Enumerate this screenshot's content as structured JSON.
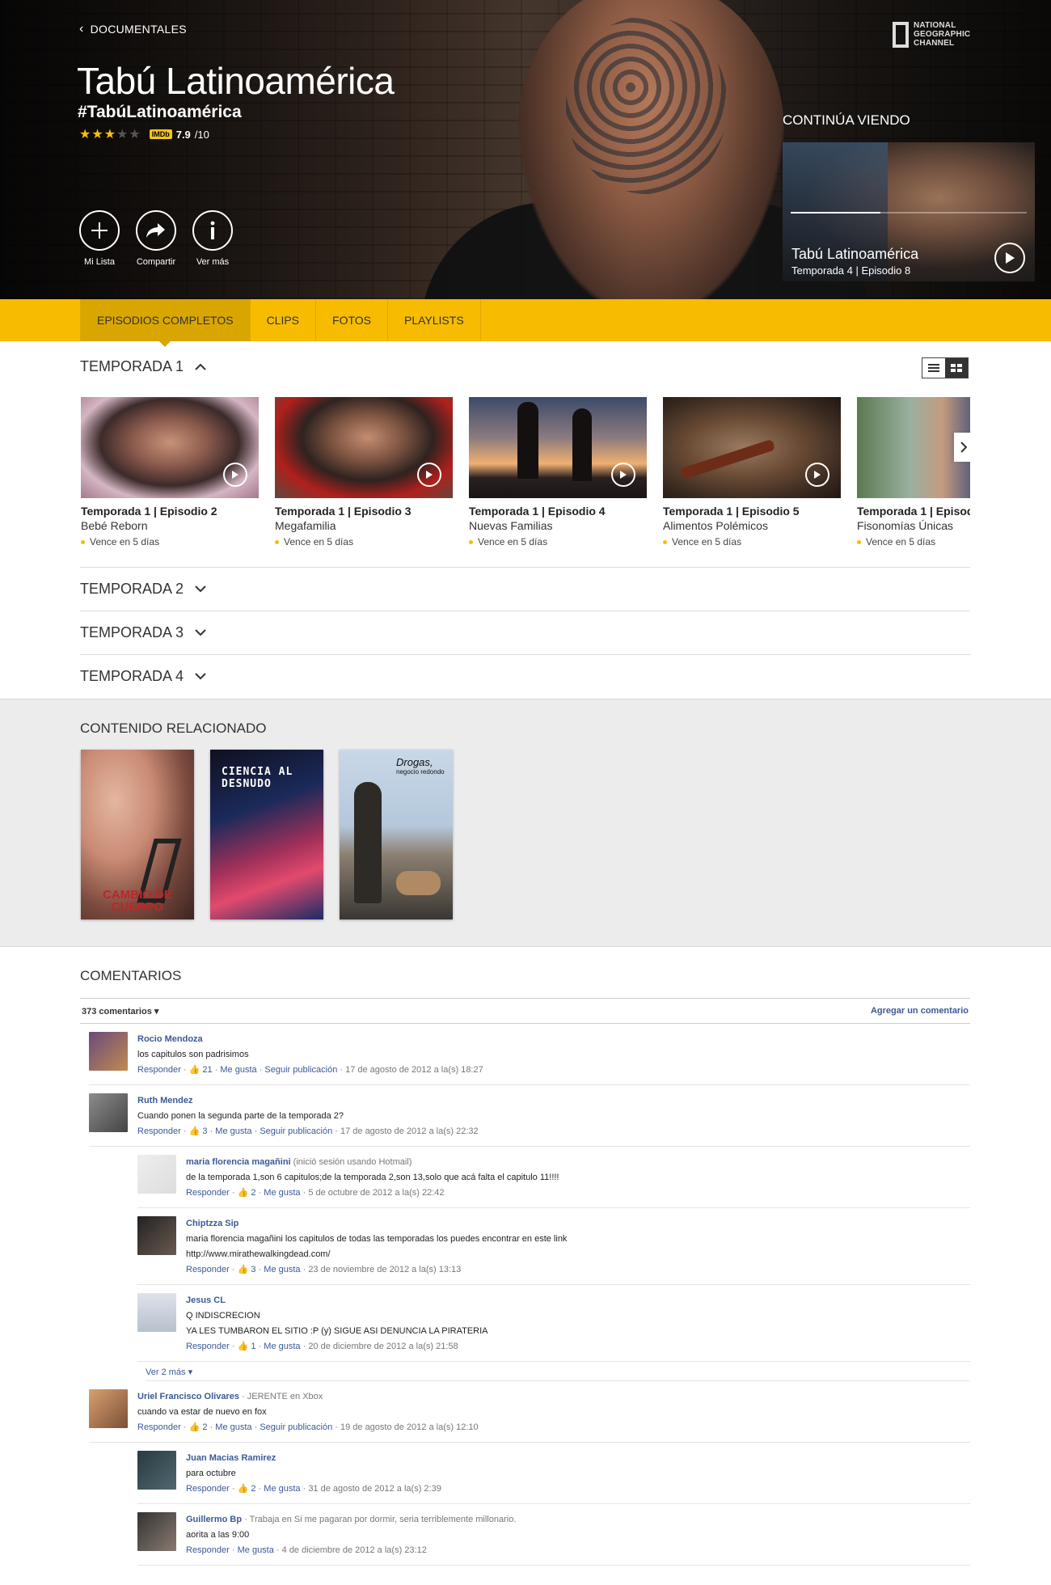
{
  "hero": {
    "back_label": "DOCUMENTALES",
    "brand": [
      "NATIONAL",
      "GEOGRAPHIC",
      "CHANNEL"
    ],
    "title": "Tabú Latinoamérica",
    "hashtag": "#TabúLatinoamérica",
    "stars_filled": 3,
    "stars_total": 5,
    "imdb_badge": "IMDb",
    "imdb_score": "7.9",
    "imdb_max": "/10",
    "actions": {
      "my_list": "Mi Lista",
      "share": "Compartir",
      "more": "Ver más"
    },
    "continue": {
      "label": "CONTINÚA VIENDO",
      "show": "Tabú Latinoamérica",
      "episode": "Temporada 4 | Episodio 8",
      "progress": 0.38
    }
  },
  "tabs": [
    "EPISODIOS COMPLETOS",
    "CLIPS",
    "FOTOS",
    "PLAYLISTS"
  ],
  "season1": {
    "label": "TEMPORADA 1",
    "episodes": [
      {
        "title": "Temporada 1 | Episodio 2",
        "name": "Bebé Reborn",
        "expires": "Vence en 5 días"
      },
      {
        "title": "Temporada 1 | Episodio 3",
        "name": "Megafamilia",
        "expires": "Vence en 5 días"
      },
      {
        "title": "Temporada 1 | Episodio 4",
        "name": "Nuevas Familias",
        "expires": "Vence en 5 días"
      },
      {
        "title": "Temporada 1 | Episodio 5",
        "name": "Alimentos Polémicos",
        "expires": "Vence en 5 días"
      },
      {
        "title": "Temporada 1 | Episodi",
        "name": "Fisonomías Únicas",
        "expires": "Vence en 5 días"
      }
    ]
  },
  "seasons": [
    "TEMPORADA 2",
    "TEMPORADA 3",
    "TEMPORADA 4"
  ],
  "related": {
    "title": "CONTENIDO RELACIONADO",
    "posters": [
      "CAMBIO DE CUERPO",
      "CIENCIA AL DESNUDO",
      "Drogas,",
      "negocio redondo"
    ]
  },
  "comments": {
    "title": "COMENTARIOS",
    "count": "373 comentarios",
    "add": "Agregar un comentario",
    "items": [
      {
        "name": "Rocio Mendoza",
        "meta": "",
        "text": "los capitulos son padrisimos",
        "text2": "",
        "likes": "21",
        "follow": true,
        "date": "17 de agosto de 2012 a la(s) 18:27"
      },
      {
        "name": "Ruth Mendez",
        "meta": "",
        "text": "Cuando ponen la segunda parte de la temporada 2?",
        "text2": "",
        "likes": "3",
        "follow": true,
        "date": "17 de agosto de 2012 a la(s) 22:32"
      },
      {
        "name": "maria florencia magañini",
        "meta": "(inició sesión usando Hotmail)",
        "text": "de la temporada 1,son 6 capitulos;de la temporada 2,son 13,solo que acá falta el capitulo 11!!!!",
        "text2": "",
        "likes": "2",
        "follow": false,
        "date": "5 de octubre de 2012 a la(s) 22:42"
      },
      {
        "name": "Chiptzza Sip",
        "meta": "",
        "text": "maria florencia magañini los capitulos de todas las temporadas los puedes encontrar en este link",
        "text2": "http://www.mirathewalkingdead.com/",
        "likes": "3",
        "follow": false,
        "date": "23 de noviembre de 2012 a la(s) 13:13"
      },
      {
        "name": "Jesus CL",
        "meta": "",
        "text": "Q INDISCRECION",
        "text2": "YA LES TUMBARON EL SITIO :P (y) SIGUE ASI DENUNCIA LA PIRATERIA",
        "likes": "1",
        "follow": false,
        "date": "20 de diciembre de 2012 a la(s) 21:58"
      },
      {
        "name": "Uriel Francisco Olivares",
        "meta": "· JERENTE en Xbox",
        "text": "cuando va estar de nuevo en fox",
        "text2": "",
        "likes": "2",
        "follow": true,
        "date": "19 de agosto de 2012 a la(s) 12:10"
      },
      {
        "name": "Juan Macias Ramirez",
        "meta": "",
        "text": "para octubre",
        "text2": "",
        "likes": "2",
        "follow": false,
        "date": "31 de agosto de 2012 a la(s) 2:39"
      },
      {
        "name": "Guillermo Bp",
        "meta": "· Trabaja en Si me pagaran por dormir, seria terriblemente millonario.",
        "text": "aorita a las 9:00",
        "text2": "",
        "likes": "",
        "follow": false,
        "date": "4 de diciembre de 2012 a la(s) 23:12"
      }
    ],
    "reply_label": "Responder",
    "like_label": "Me gusta",
    "follow_label": "Seguir publicación",
    "more_label": "Ver 2 más"
  }
}
